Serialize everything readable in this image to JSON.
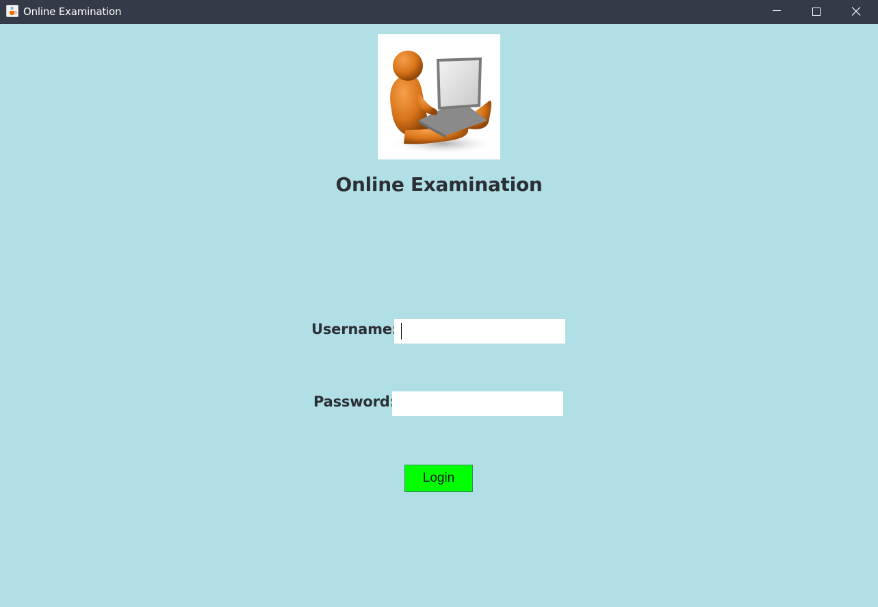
{
  "window": {
    "title": "Online Examination",
    "app_icon": "java-cup-icon",
    "controls": [
      "minimize-icon",
      "maximize-icon",
      "close-icon"
    ],
    "titlebar_color": "#343a48",
    "background_color": "#b0dfe5"
  },
  "hero": {
    "image": "person-with-laptop-illustration"
  },
  "form": {
    "heading": "Online Examination",
    "username_label": "Username:",
    "username_value": "",
    "password_label": "Password:",
    "password_value": "",
    "login_label": "Login",
    "login_color": "#00ff00"
  }
}
